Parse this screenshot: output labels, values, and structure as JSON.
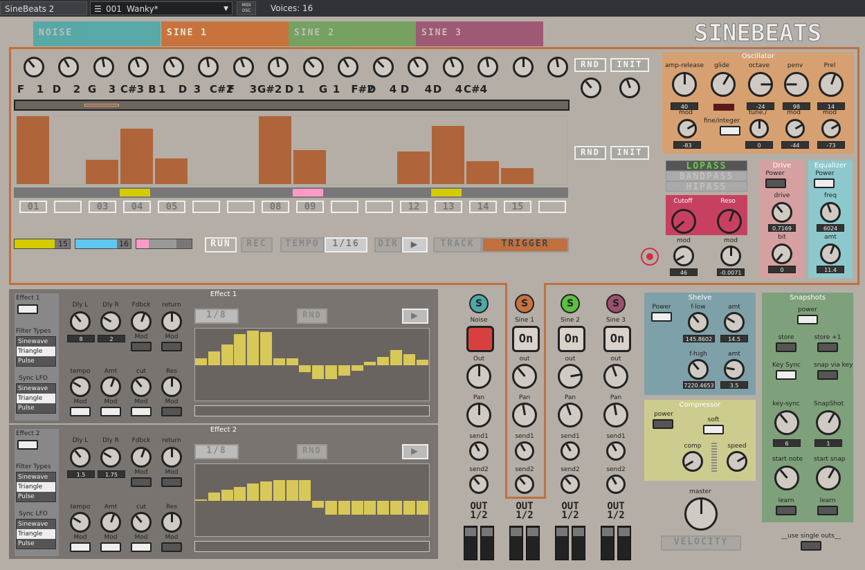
{
  "topbar": {
    "app": "SineBeats 2",
    "preset_num": "001",
    "preset_name": "Wanky*",
    "midi": "MIDI",
    "osc": "OSC",
    "voices": "Voices: 16"
  },
  "tabs": [
    {
      "label": "NOISE",
      "color": "#4fa8a8"
    },
    {
      "label": "SINE 1",
      "color": "#c8733e"
    },
    {
      "label": "SINE 2",
      "color": "#6fa05a"
    },
    {
      "label": "SINE 3",
      "color": "#9c5070"
    }
  ],
  "logo": "SINEBEATS",
  "notes": [
    "F",
    "1",
    "D",
    "2",
    "G",
    "3",
    "C#3",
    "B",
    "1",
    "D",
    "3",
    "C#2",
    "F",
    "3",
    "G#2",
    "D",
    "1",
    "G",
    "1",
    "F#2",
    "D",
    "4",
    "D",
    "4",
    "D",
    "4",
    "C#4"
  ],
  "step_numbers": [
    "01",
    "",
    "03",
    "04",
    "05",
    "",
    "",
    "08",
    "09",
    "",
    "",
    "12",
    "13",
    "14",
    "15",
    ""
  ],
  "step_heights": [
    0.98,
    0,
    0.35,
    0.8,
    0.37,
    0,
    0,
    0.98,
    0.49,
    0,
    0,
    0.47,
    0.84,
    0.33,
    0.23,
    0
  ],
  "step_markers": [
    {
      "step": 3,
      "color": "#d4cc00"
    },
    {
      "step": 8,
      "color": "#ff9ac8"
    },
    {
      "step": 12,
      "color": "#d4cc00"
    }
  ],
  "rnd": "RND",
  "init": "INIT",
  "lengths": [
    "15",
    "16"
  ],
  "transport": {
    "run": "RUN",
    "rec": "REC",
    "tempo": "TEMPO",
    "tempo_val": "1/16",
    "dir": "DIR",
    "play": "▶",
    "track": "TRACK",
    "trigger": "TRIGGER"
  },
  "osc": {
    "title": "Oscillator",
    "labels": [
      "amp-release",
      "glide",
      "octave",
      "penv",
      "Prel"
    ],
    "values": [
      "40",
      "",
      "-24",
      "98",
      "14"
    ],
    "mod_labels": [
      "mod",
      "fine/integer",
      "tune./",
      "mod",
      "mod"
    ],
    "mod_values": [
      "-83",
      "0",
      "-44",
      "-73"
    ]
  },
  "filter": {
    "types": [
      "LOPASS",
      "BANDPASS",
      "HIPASS"
    ],
    "cutoff": "Cutoff",
    "reso": "Reso",
    "mod": "mod",
    "mod1_val": "46",
    "mod2_val": "-0.0071"
  },
  "drive": {
    "title": "Drive",
    "power": "Power",
    "drive": "drive",
    "drive_val": "0.7169",
    "bit": "bit",
    "bit_val": "0"
  },
  "eq": {
    "title": "Equalizer",
    "power": "Power",
    "freq": "freq",
    "freq_val": "6024",
    "amt": "amt",
    "amt_val": "11.4"
  },
  "effect1": {
    "title": "Effect 1",
    "name": "Effect 1",
    "labels": [
      "Dly L",
      "Dly R",
      "Fdbck",
      "return"
    ],
    "vals": [
      "8",
      "2"
    ],
    "mod": "Mod",
    "filter_types": "Filter Types",
    "sync_lfo": "Sync LFO",
    "list": [
      "Sinewave",
      "Triangle",
      "Pulse"
    ],
    "lfo_labels": [
      "tempo",
      "Amt",
      "cut",
      "Res"
    ],
    "rate": "1/8",
    "rnd": "RND",
    "play": "▶",
    "bars": [
      0.1,
      0.2,
      0.3,
      0.45,
      0.5,
      0.48,
      0.1,
      0.1,
      -0.1,
      -0.2,
      -0.2,
      -0.15,
      -0.08,
      0.05,
      0.12,
      0.22,
      0.16,
      0.08
    ]
  },
  "effect2": {
    "title": "Effect 2",
    "name": "Effect 2",
    "labels": [
      "Dly L",
      "Dly R",
      "Fdbck",
      "return"
    ],
    "vals": [
      "1.5",
      "1.75"
    ],
    "mod": "Mod",
    "filter_types": "Filter Types",
    "sync_lfo": "Sync LFO",
    "list": [
      "Sinewave",
      "Triangle",
      "Pulse"
    ],
    "lfo_labels": [
      "tempo",
      "Amt",
      "cut",
      "Res"
    ],
    "rate": "1/8",
    "rnd": "RND",
    "play": "▶",
    "bars": [
      0.02,
      0.12,
      0.16,
      0.2,
      0.25,
      0.28,
      0.3,
      0.3,
      0.3,
      -0.1,
      -0.2,
      -0.2,
      -0.2,
      -0.2,
      -0.2,
      -0.2,
      -0.2,
      -0.2
    ]
  },
  "mixer": [
    {
      "s": "S",
      "name": "Noise",
      "color": "#4fa8a8",
      "top": "",
      "out": "Out",
      "pan": "Pan",
      "send1": "send1",
      "send2": "send2",
      "outlbl": "OUT\n1/2"
    },
    {
      "s": "S",
      "name": "Sine 1",
      "color": "#c8733e",
      "top": "On",
      "out": "out",
      "pan": "Pan",
      "send1": "send1",
      "send2": "send2",
      "outlbl": "OUT\n1/2"
    },
    {
      "s": "S",
      "name": "Sine 2",
      "color": "#5cc040",
      "top": "On",
      "out": "out",
      "pan": "Pan",
      "send1": "send1",
      "send2": "send2",
      "outlbl": "OUT\n1/2"
    },
    {
      "s": "S",
      "name": "Sine 3",
      "color": "#9c5070",
      "top": "On",
      "out": "out",
      "pan": "Pan",
      "send1": "send1",
      "send2": "send2",
      "outlbl": "OUT\n1/2"
    }
  ],
  "shelve": {
    "title": "Shelve",
    "power": "Power",
    "flow": "f-low",
    "flow_val": "145.8602",
    "amt": "amt",
    "amt1_val": "14.5",
    "fhigh": "f-high",
    "fhigh_val": "7220.4653",
    "amt2_val": "3.5"
  },
  "compressor": {
    "title": "Compressor",
    "power": "power",
    "soft": "soft",
    "comp": "comp",
    "speed": "speed"
  },
  "master": {
    "label": "master",
    "velocity": "VELOCITY"
  },
  "snapshots": {
    "title": "Snapshots",
    "power": "power",
    "store": "store",
    "store1": "store +1",
    "keysync": "Key Sync",
    "snapkey": "snap via key",
    "keysync2": "key-sync",
    "snapshot": "SnapShot",
    "ks_val": "6",
    "ss_val": "1",
    "startnote": "start note",
    "startsnap": "start snap",
    "learn": "learn"
  },
  "single_outs": "__use single outs__"
}
